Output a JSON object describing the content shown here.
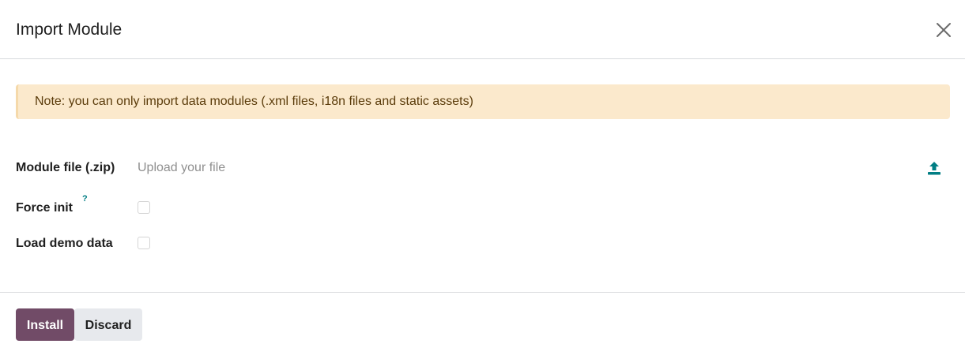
{
  "dialog": {
    "title": "Import Module",
    "close_icon": "close-icon"
  },
  "alert": {
    "text": "Note: you can only import data modules (.xml files, i18n files and static assets)"
  },
  "form": {
    "module_file": {
      "label": "Module file (.zip)",
      "placeholder": "Upload your file",
      "icon": "upload-icon"
    },
    "force_init": {
      "label": "Force init",
      "help": "?",
      "checked": false
    },
    "load_demo": {
      "label": "Load demo data",
      "checked": false
    }
  },
  "footer": {
    "install_label": "Install",
    "discard_label": "Discard"
  },
  "colors": {
    "primary": "#714b67",
    "alert_bg": "#fbe9cc",
    "alert_text": "#5b3c0b",
    "help": "#017e84",
    "upload_icon": "#017e84"
  }
}
